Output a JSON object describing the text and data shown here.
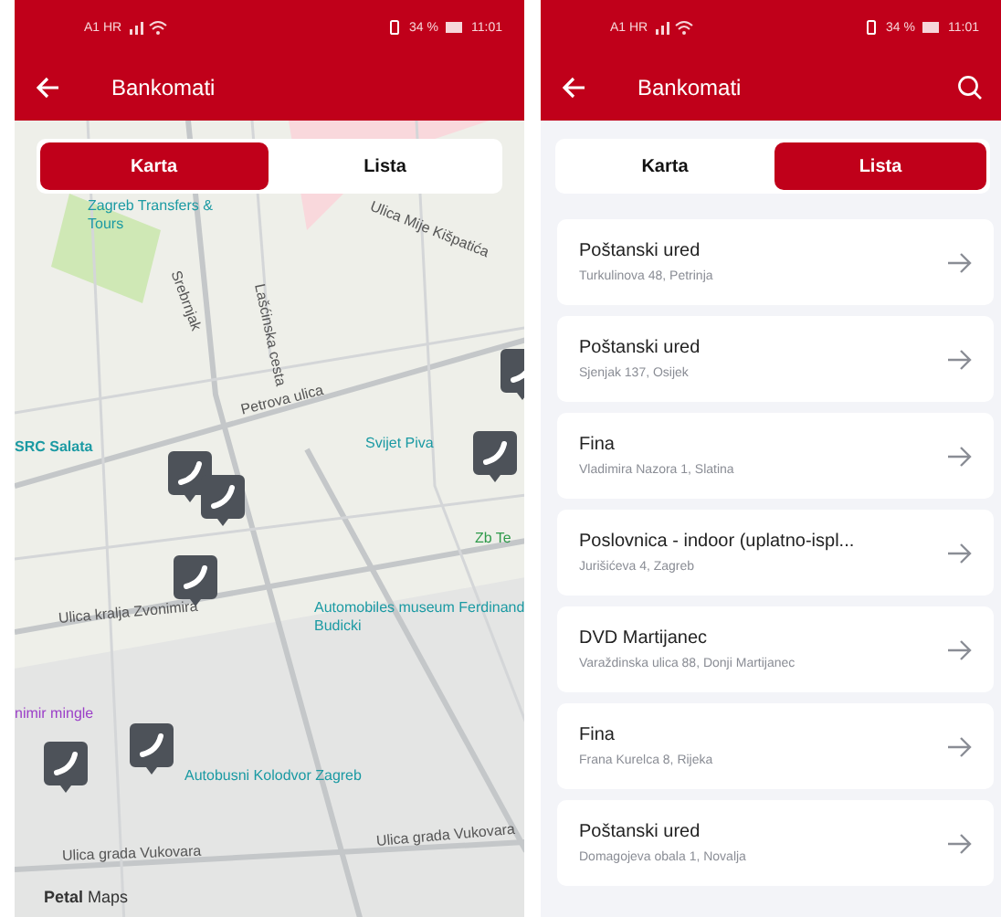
{
  "screens": [
    {
      "status_bar": {
        "carrier": "A1 HR",
        "battery": "34 %",
        "time": "11:01"
      },
      "title": "Bankomati",
      "search_button": false,
      "tabs": [
        {
          "label": "Karta",
          "selected": true
        },
        {
          "label": "Lista",
          "selected": false
        }
      ],
      "view": {
        "kind": "map",
        "attribution": "**Petal** Maps",
        "labels": [
          {
            "text": "Zagreb Transfers & Tours",
            "kind": "poi"
          },
          {
            "text": "Srebrnjak",
            "kind": "street"
          },
          {
            "text": "Lašćinska cesta",
            "kind": "street"
          },
          {
            "text": "Ulica Mije Kišpatića",
            "kind": "street"
          },
          {
            "text": "Petrova ulica",
            "kind": "street"
          },
          {
            "text": "SRC Salata",
            "kind": "place"
          },
          {
            "text": "Svijet Piva",
            "kind": "poi"
          },
          {
            "text": "Zb Te",
            "kind": "park"
          },
          {
            "text": "Ulica kralja Zvonimira",
            "kind": "street"
          },
          {
            "text": "Automobiles museum Ferdinand Budicki",
            "kind": "poi"
          },
          {
            "text": "nimir mingle",
            "kind": "venue"
          },
          {
            "text": "Autobusni Kolodvor Zagreb",
            "kind": "poi"
          },
          {
            "text": "Ulica grada Vukovara",
            "kind": "street"
          },
          {
            "text": "Ulica grada Vukovara",
            "kind": "street"
          }
        ]
      }
    },
    {
      "status_bar": {
        "carrier": "A1 HR",
        "battery": "34 %",
        "time": "11:01"
      },
      "title": "Bankomati",
      "search_button": true,
      "tabs": [
        {
          "label": "Karta",
          "selected": false
        },
        {
          "label": "Lista",
          "selected": true
        }
      ],
      "view": {
        "kind": "list",
        "items": [
          {
            "name": "Poštanski ured",
            "address": "Turkulinova 48, Petrinja"
          },
          {
            "name": "Poštanski ured",
            "address": "Sjenjak 137, Osijek"
          },
          {
            "name": "Fina",
            "address": "Vladimira Nazora 1, Slatina"
          },
          {
            "name": "Poslovnica - indoor (uplatno-ispl...",
            "address": "Jurišićeva 4, Zagreb"
          },
          {
            "name": "DVD Martijanec",
            "address": "Varaždinska ulica 88, Donji Martijanec"
          },
          {
            "name": "Fina",
            "address": "Frana Kurelca 8, Rijeka"
          },
          {
            "name": "Poštanski ured",
            "address": "Domagojeva obala 1, Novalja"
          }
        ]
      }
    }
  ]
}
